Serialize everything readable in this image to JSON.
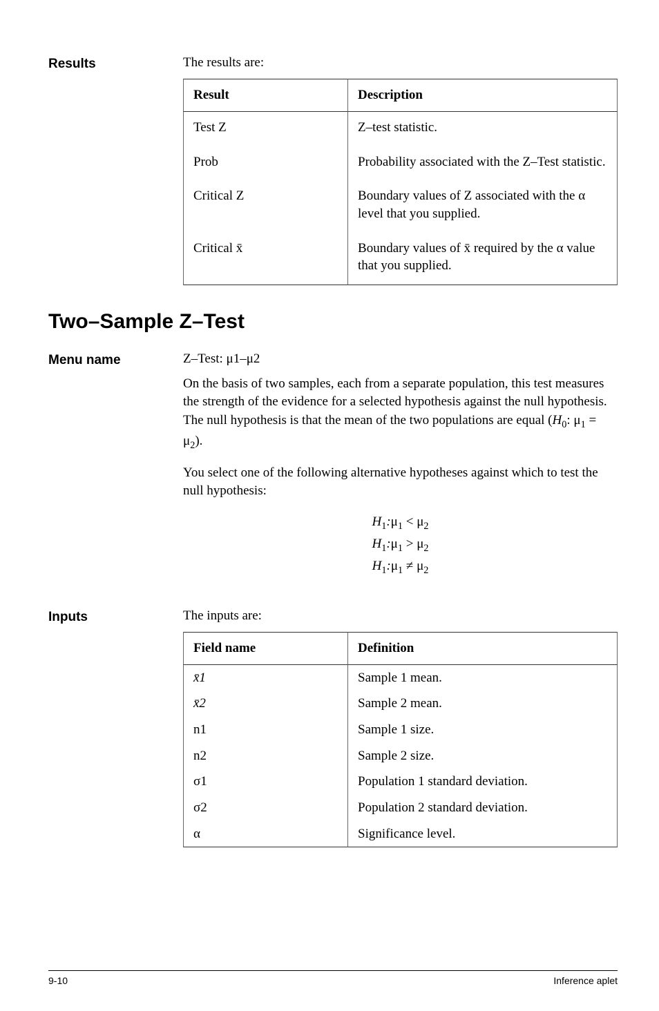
{
  "results": {
    "label": "Results",
    "intro": "The results are:",
    "header_col1": "Result",
    "header_col2": "Description",
    "rows": [
      {
        "name": "Test Z",
        "desc": "Z–test statistic."
      },
      {
        "name": "Prob",
        "desc": "Probability associated with the Z–Test statistic."
      },
      {
        "name": "Critical Z",
        "desc": "Boundary values of Z associated with the α level that you supplied."
      },
      {
        "name": "Critical x̄",
        "desc": "Boundary values of x̄ required by the α value that you supplied."
      }
    ]
  },
  "section_title": "Two–Sample Z–Test",
  "menu": {
    "label": "Menu name",
    "name": "Z–Test: μ1–μ2",
    "para1_part1": "On the basis of two samples, each from a separate population, this test measures the strength of the evidence for a selected hypothesis against the null hypothesis. The null hypothesis is that the mean of the two populations are equal (",
    "para1_h0": "H",
    "para1_part2": ": μ",
    "para1_part3": " = μ",
    "para1_part4": ").",
    "para2": "You select one of the following alternative hypotheses against which to test the null hypothesis:",
    "hyp": {
      "h_sym": "H",
      "mu": "μ",
      "lt": " < ",
      "gt": " > ",
      "ne": " ≠ ",
      "sub1": "1",
      "sub2": "2",
      "colon": ":"
    }
  },
  "inputs": {
    "label": "Inputs",
    "intro": "The inputs are:",
    "header_col1": "Field name",
    "header_col2": "Definition",
    "rows": [
      {
        "name": "x̄1",
        "desc": "Sample 1 mean.",
        "italic": true
      },
      {
        "name": "x̄2",
        "desc": "Sample 2 mean.",
        "italic": true
      },
      {
        "name": "n1",
        "desc": "Sample 1 size."
      },
      {
        "name": "n2",
        "desc": "Sample 2 size."
      },
      {
        "name": "σ1",
        "desc": "Population 1 standard deviation."
      },
      {
        "name": "σ2",
        "desc": "Population 2 standard deviation."
      },
      {
        "name": "α",
        "desc": "Significance level."
      }
    ]
  },
  "footer": {
    "page": "9-10",
    "title": "Inference aplet"
  }
}
